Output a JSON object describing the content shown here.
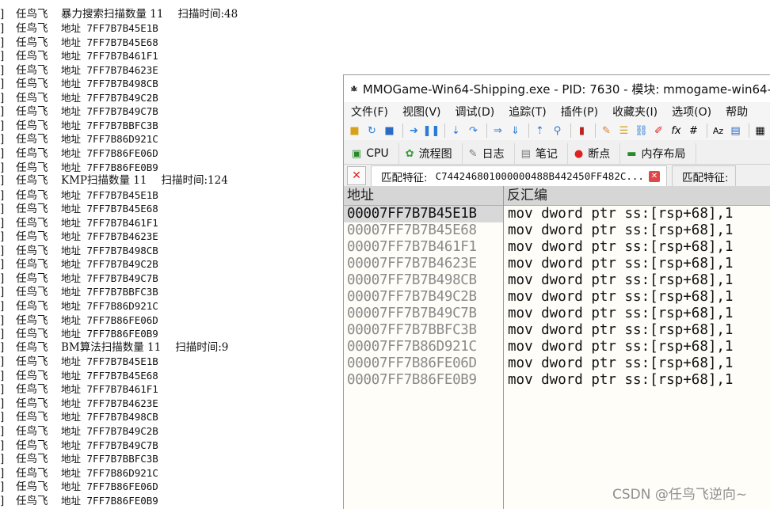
{
  "console": {
    "prefix": "]",
    "name": "任鸟飞",
    "groups": [
      {
        "title": "暴力搜索扫描数量 11",
        "time": "扫描时间:48",
        "entries": [
          "地址 7FF7B7B45E1B",
          "地址 7FF7B7B45E68",
          "地址 7FF7B7B461F1",
          "地址 7FF7B7B4623E",
          "地址 7FF7B7B498CB",
          "地址 7FF7B7B49C2B",
          "地址 7FF7B7B49C7B",
          "地址 7FF7B7BBFC3B",
          "地址 7FF7B86D921C",
          "地址 7FF7B86FE06D",
          "地址 7FF7B86FE0B9"
        ]
      },
      {
        "title": "KMP扫描数量 11",
        "time": "扫描时间:124",
        "entries": [
          "地址 7FF7B7B45E1B",
          "地址 7FF7B7B45E68",
          "地址 7FF7B7B461F1",
          "地址 7FF7B7B4623E",
          "地址 7FF7B7B498CB",
          "地址 7FF7B7B49C2B",
          "地址 7FF7B7B49C7B",
          "地址 7FF7B7BBFC3B",
          "地址 7FF7B86D921C",
          "地址 7FF7B86FE06D",
          "地址 7FF7B86FE0B9"
        ]
      },
      {
        "title": "BM算法扫描数量 11",
        "time": "扫描时间:9",
        "entries": [
          "地址 7FF7B7B45E1B",
          "地址 7FF7B7B45E68",
          "地址 7FF7B7B461F1",
          "地址 7FF7B7B4623E",
          "地址 7FF7B7B498CB",
          "地址 7FF7B7B49C2B",
          "地址 7FF7B7B49C7B",
          "地址 7FF7B7BBFC3B",
          "地址 7FF7B86D921C",
          "地址 7FF7B86FE06D",
          "地址 7FF7B86FE0B9"
        ]
      }
    ]
  },
  "window": {
    "title": "MMOGame-Win64-Shipping.exe - PID: 7630 - 模块: mmogame-win64-",
    "menu": [
      "文件(F)",
      "视图(V)",
      "调试(D)",
      "追踪(T)",
      "插件(P)",
      "收藏夹(I)",
      "选项(O)",
      "帮助"
    ],
    "tabs": [
      {
        "label": "CPU",
        "icon": "cpu-icon"
      },
      {
        "label": "流程图",
        "icon": "graph-icon"
      },
      {
        "label": "日志",
        "icon": "log-icon"
      },
      {
        "label": "笔记",
        "icon": "notes-icon"
      },
      {
        "label": "断点",
        "icon": "breakpoint-icon"
      },
      {
        "label": "内存布局",
        "icon": "memory-icon"
      }
    ],
    "subtabs": {
      "active_label": "匹配特征:",
      "active_pattern": "C744246801000000488B442450FF482C...",
      "inactive_label": "匹配特征:"
    },
    "grid": {
      "col_address": "地址",
      "col_disasm": "反汇编",
      "rows": [
        {
          "addr": "00007FF7B7B45E1B",
          "disasm": "mov dword ptr ss:[rsp+68],1",
          "selected": true
        },
        {
          "addr": "00007FF7B7B45E68",
          "disasm": "mov dword ptr ss:[rsp+68],1"
        },
        {
          "addr": "00007FF7B7B461F1",
          "disasm": "mov dword ptr ss:[rsp+68],1"
        },
        {
          "addr": "00007FF7B7B4623E",
          "disasm": "mov dword ptr ss:[rsp+68],1"
        },
        {
          "addr": "00007FF7B7B498CB",
          "disasm": "mov dword ptr ss:[rsp+68],1"
        },
        {
          "addr": "00007FF7B7B49C2B",
          "disasm": "mov dword ptr ss:[rsp+68],1"
        },
        {
          "addr": "00007FF7B7B49C7B",
          "disasm": "mov dword ptr ss:[rsp+68],1"
        },
        {
          "addr": "00007FF7B7BBFC3B",
          "disasm": "mov dword ptr ss:[rsp+68],1"
        },
        {
          "addr": "00007FF7B86D921C",
          "disasm": "mov dword ptr ss:[rsp+68],1"
        },
        {
          "addr": "00007FF7B86FE06D",
          "disasm": "mov dword ptr ss:[rsp+68],1"
        },
        {
          "addr": "00007FF7B86FE0B9",
          "disasm": "mov dword ptr ss:[rsp+68],1"
        }
      ]
    }
  },
  "watermark": "CSDN @任鸟飞逆向~"
}
